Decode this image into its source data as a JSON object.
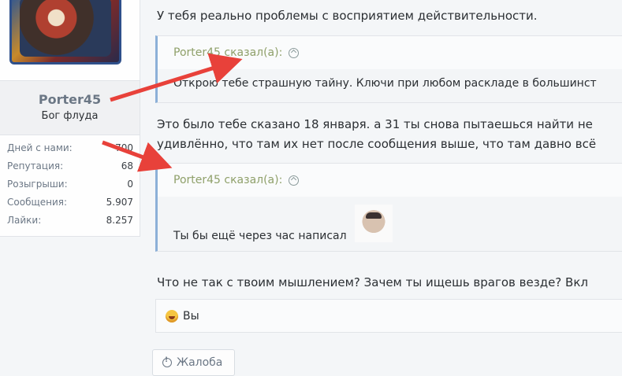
{
  "user": {
    "name": "Porter45",
    "title": "Бог флуда",
    "stats": [
      {
        "label": "Дней с нами:",
        "value": "700"
      },
      {
        "label": "Репутация:",
        "value": "68"
      },
      {
        "label": "Розыгрыши:",
        "value": "0"
      },
      {
        "label": "Сообщения:",
        "value": "5.907"
      },
      {
        "label": "Лайки:",
        "value": "8.257"
      }
    ]
  },
  "post": {
    "line1": "У тебя реально проблемы с восприятием действительности.",
    "quote1": {
      "author": "Porter45 сказал(а):",
      "text": "Открою тебе страшную тайну. Ключи при любом раскладе в большинст"
    },
    "line2": "Это было тебе сказано 18 января. а 31 ты снова пытаешься найти нe",
    "line3": "удивлённо, что там их нет после сообщения выше, что там давно всё",
    "quote2": {
      "author": "Porter45 сказал(а):",
      "text": "Ты бы ещё через час написал"
    },
    "line4": "Что не так с твоим мышлением? Зачем ты ищешь врагов везде? Вкл",
    "reaction_label": "Вы",
    "report_label": "Жалоба"
  },
  "colors": {
    "arrow": "#e8413a",
    "quote_border": "#8cb0d8",
    "author": "#8fa06a"
  }
}
